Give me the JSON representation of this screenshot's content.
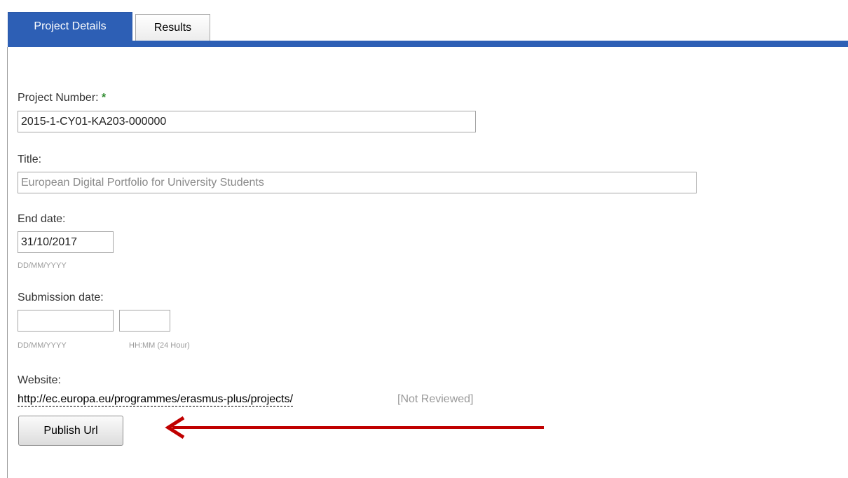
{
  "tabs": [
    {
      "label": "Project Details",
      "active": true
    },
    {
      "label": "Results",
      "active": false
    }
  ],
  "form": {
    "project_number": {
      "label": "Project Number:",
      "required_marker": "*",
      "value": "2015-1-CY01-KA203-000000"
    },
    "title": {
      "label": "Title:",
      "value": "European Digital Portfolio for University Students"
    },
    "end_date": {
      "label": "End date:",
      "value": "31/10/2017",
      "hint": "DD/MM/YYYY"
    },
    "submission_date": {
      "label": "Submission date:",
      "date_value": "",
      "time_value": "",
      "date_hint": "DD/MM/YYYY",
      "time_hint": "HH:MM (24 Hour)"
    },
    "website": {
      "label": "Website:",
      "url": "http://ec.europa.eu/programmes/erasmus-plus/projects/",
      "status": "[Not Reviewed]"
    },
    "publish_button_label": "Publish Url"
  },
  "colors": {
    "tab_active": "#2d5fb5",
    "required_star": "#2e8b2e",
    "annotation_arrow": "#c00000",
    "muted_text": "#9a9a9a"
  },
  "annotation": {
    "icon": "left-arrow-icon"
  }
}
